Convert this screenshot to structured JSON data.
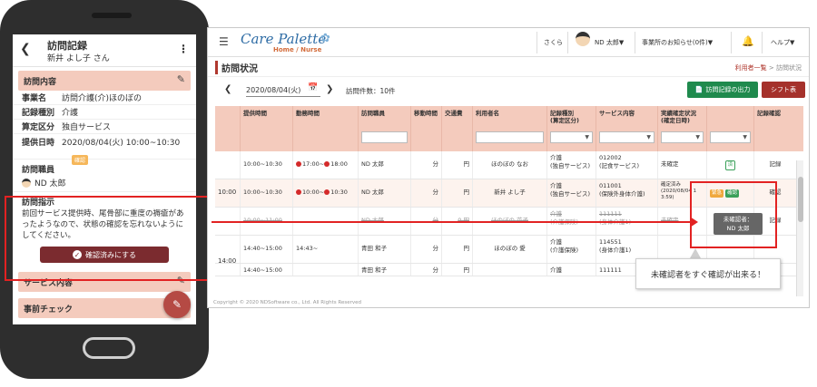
{
  "mobile": {
    "title": "訪問記録",
    "subtitle": "新井 よし子 さん",
    "section_visit": "訪問内容",
    "rows": [
      {
        "key": "事業名",
        "value": "訪問介護(介)ほのぼの"
      },
      {
        "key": "記録種別",
        "value": "介護"
      },
      {
        "key": "算定区分",
        "value": "独自サービス"
      },
      {
        "key": "提供日時",
        "value": "2020/08/04(火) 10:00~10:30"
      }
    ],
    "badge": "確認",
    "staff_label": "訪問職員",
    "staff_name": "ND 太郎",
    "instruction_label": "訪問指示",
    "instruction_text": "前回サービス提供時、尾骨部に重度の褥瘡があったようなので、状態の確認を忘れないようにしてください。",
    "confirm_button": "確認済みにする",
    "section_service": "サービス内容",
    "section_precheck": "事前チェック"
  },
  "desktop": {
    "app_name": "Care Palette",
    "app_sub": "Home / Nurse",
    "top_items": {
      "office": "さくら",
      "user": "ND 太郎▼",
      "notice": "事業所のお知らせ(0件)▼",
      "help": "ヘルプ▼"
    },
    "page_title": "訪問状況",
    "breadcrumb_link": "利用者一覧",
    "breadcrumb_current": "訪問状況",
    "date": "2020/08/04(火)",
    "visit_count": "訪問件数：10件",
    "export_button": "訪問記録の出力",
    "shift_button": "シフト表",
    "headers": [
      "提供時間",
      "勤務時間",
      "訪問職員",
      "移動時間",
      "交通費",
      "利用者名",
      "記録種別\n(算定区分)",
      "サービス内容",
      "実績確定状況\n(確定日時)",
      "",
      "記録確認"
    ],
    "rows": [
      {
        "time": "10:00~10:30",
        "work_start": "17:00~",
        "work_end": "18:00",
        "staff": "ND 太郎",
        "move": "分",
        "fare": "円",
        "user": "ほのぼの なお",
        "kind": "介護\n(独自サービス)",
        "service": "012002\n(記食サービス)",
        "status": "未確定",
        "flag": "済",
        "check": "記録"
      },
      {
        "time": "10:00~10:30",
        "work_start": "10:00~",
        "work_end": "10:30",
        "staff": "ND 太郎",
        "move": "分",
        "fare": "円",
        "user": "新井 よし子",
        "kind": "介護\n(独自サービス)",
        "service": "011001\n(保険外身体介護)",
        "status": "確定済み\n(2020/08/04 1\n3:59)",
        "flag": "",
        "check": "確認"
      },
      {
        "time": "10:00~11:00",
        "work_start": "",
        "work_end": "",
        "staff": "ND 太郎",
        "move": "分",
        "fare": "0 円",
        "user": "ほのぼの 花子",
        "kind": "介護\n(介護保険)",
        "service": "111111\n(身体介護1)",
        "status": "未確定",
        "flag": "",
        "check": "記録"
      },
      {
        "time": "14:40~15:00",
        "work_start": "14:43~",
        "work_end": "",
        "staff": "青田 和子",
        "move": "分",
        "fare": "円",
        "user": "ほのぼの 愛",
        "kind": "介護\n(介護保険)",
        "service": "114551\n(身体介護1)",
        "status": "",
        "flag": "",
        "check": ""
      },
      {
        "time": "14:40~15:00",
        "work_start": "",
        "work_end": "",
        "staff": "青田 和子",
        "move": "分",
        "fare": "円",
        "user": "",
        "kind": "介護",
        "service": "111111",
        "status": "",
        "flag": "",
        "check": ""
      }
    ],
    "timebands": [
      "10:00",
      "14:00"
    ],
    "tag_kaigo": "緊急",
    "tag_confirm": "確認",
    "tooltip_title": "未確認者：",
    "tooltip_name": "ND 太郎",
    "footer": "Copyright © 2020 NDSoftware co., Ltd. All Rights Reserved",
    "callout": "未確認者をすぐ確認が出来る！"
  },
  "colors": {
    "accent": "#b0392f",
    "header_bg": "#f4cbbd",
    "highlight": "#e22222",
    "green": "#1f8a4d"
  }
}
